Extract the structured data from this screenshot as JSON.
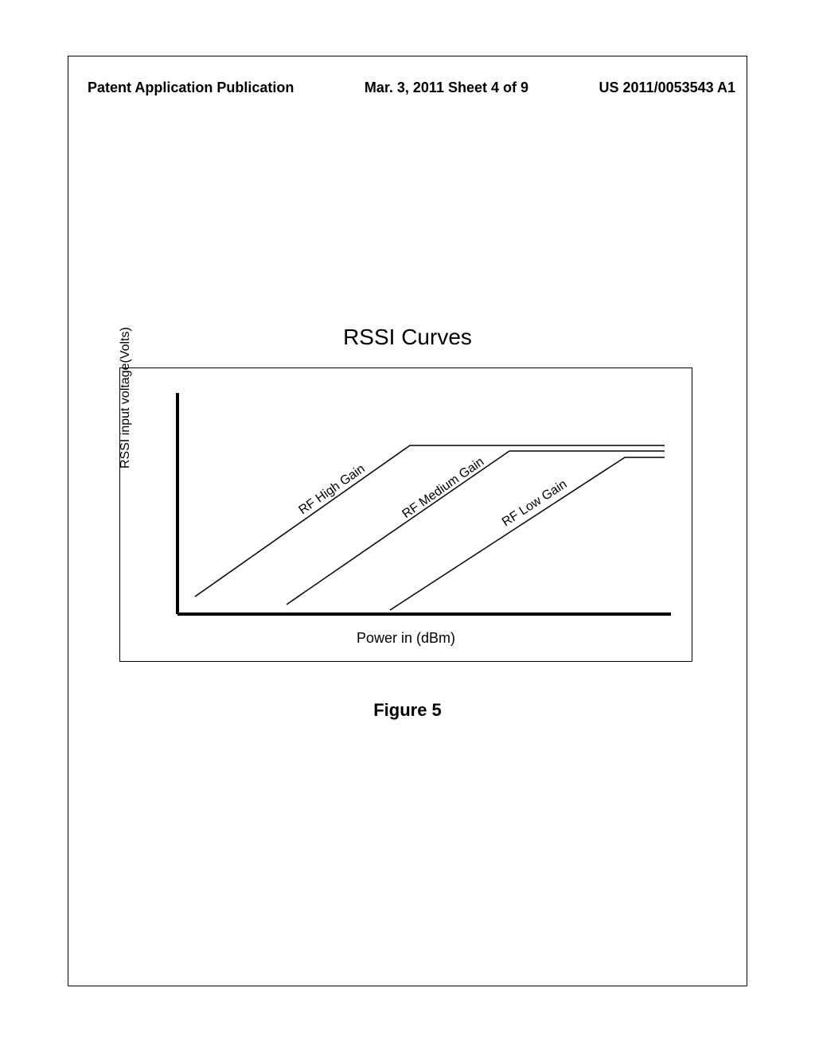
{
  "header": {
    "left": "Patent Application Publication",
    "center": "Mar. 3, 2011  Sheet 4 of 9",
    "right": "US 2011/0053543 A1"
  },
  "chart_data": {
    "type": "line",
    "title": "RSSI Curves",
    "xlabel": "Power in (dBm)",
    "ylabel": "RSSI input voltage(Volts)",
    "x": [
      0,
      20,
      40,
      60,
      80,
      100
    ],
    "series": [
      {
        "name": "RF High Gain",
        "x_start": 5,
        "y_start": 30,
        "x_knee": 50,
        "y_knee": 80,
        "x_end": 100,
        "y_end": 80
      },
      {
        "name": "RF Medium Gain",
        "x_start": 25,
        "y_start": 20,
        "x_knee": 70,
        "y_knee": 75,
        "x_end": 100,
        "y_end": 75
      },
      {
        "name": "RF Low Gain",
        "x_start": 45,
        "y_start": 15,
        "x_knee": 95,
        "y_knee": 72,
        "x_end": 100,
        "y_end": 72
      }
    ]
  },
  "figure_caption": "Figure 5"
}
